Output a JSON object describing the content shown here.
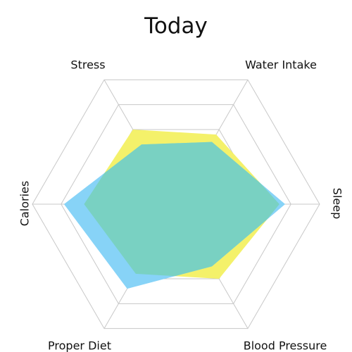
{
  "chart_data": {
    "type": "radar",
    "title": "Today",
    "axes": [
      "Stress",
      "Water Intake",
      "Sleep",
      "Blood Pressure",
      "Proper Diet",
      "Calories"
    ],
    "rlim": [
      0,
      5
    ],
    "grid": true,
    "series": [
      {
        "values": [
          3.0,
          2.8,
          3.6,
          3.0,
          2.8,
          3.2
        ],
        "color": "#f4f16a"
      },
      {
        "values": [
          2.4,
          2.5,
          3.8,
          2.5,
          3.4,
          3.9
        ],
        "color": "#87d3f7"
      }
    ],
    "overlap_color": "#79d1c2"
  }
}
